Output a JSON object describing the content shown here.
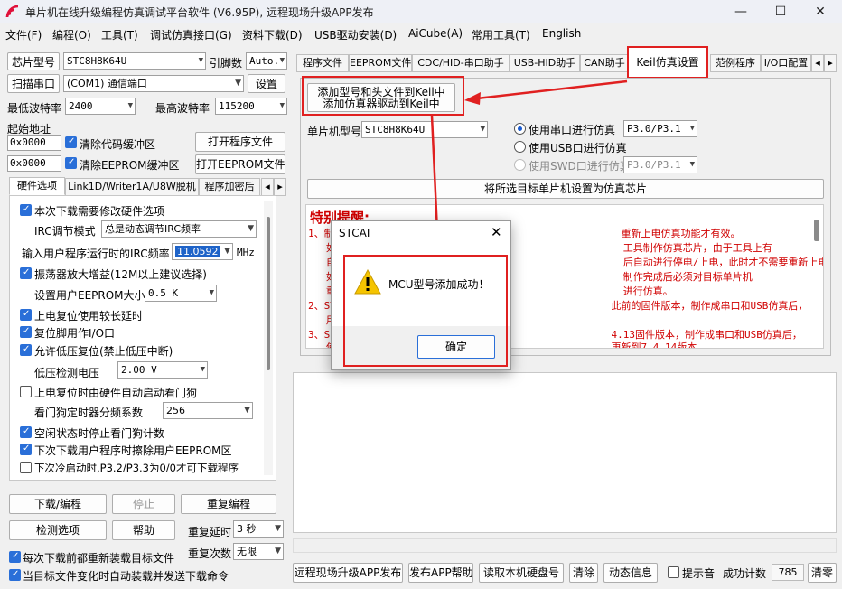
{
  "window": {
    "title": "单片机在线升级编程仿真调试平台软件 (V6.95P), 远程现场升级APP发布"
  },
  "menu": [
    "文件(F)",
    "编程(O)",
    "工具(T)",
    "调试仿真接口(G)",
    "资料下载(D)",
    "USB驱动安装(D)",
    "AiCube(A)",
    "常用工具(T)",
    "English"
  ],
  "left": {
    "chip_label": "芯片型号",
    "chip_value": "STC8H8K64U",
    "pin_label": "引脚数",
    "pin_value": "Auto.",
    "scan_btn": "扫描串口",
    "port_value": "(COM1) 通信端口",
    "settings_btn": "设置",
    "min_baud_label": "最低波特率",
    "min_baud": "2400",
    "max_baud_label": "最高波特率",
    "max_baud": "115200",
    "start_addr_label": "起始地址",
    "addr1": "0x0000",
    "clear_code": "清除代码缓冲区",
    "open_prog_btn": "打开程序文件",
    "addr2": "0x0000",
    "clear_eeprom": "清除EEPROM缓冲区",
    "open_eeprom_btn": "打开EEPROM文件",
    "tabs": [
      "硬件选项",
      "Link1D/Writer1A/U8W脱机",
      "程序加密后"
    ],
    "options": {
      "modify_hw": "本次下载需要修改硬件选项",
      "irc_mode_label": "IRC调节模式",
      "irc_mode_value": "总是动态调节IRC频率",
      "irc_freq_label": "输入用户程序运行时的IRC频率",
      "irc_freq_value": "11.0592",
      "irc_unit": "MHz",
      "osc_gain": "振荡器放大增益(12M以上建议选择)",
      "eeprom_size_label": "设置用户EEPROM大小",
      "eeprom_size_value": "0.5 K",
      "long_reset": "上电复位使用较长延时",
      "reset_io": "复位脚用作I/O口",
      "lvr": "允许低压复位(禁止低压中断)",
      "lv_label": "低压检测电压",
      "lv_value": "2.00 V",
      "wdt_hw": "上电复位时由硬件自动启动看门狗",
      "wdt_div_label": "看门狗定时器分频系数",
      "wdt_div_value": "256",
      "idle_wdt": "空闲状态时停止看门狗计数",
      "erase_eeprom": "下次下载用户程序时擦除用户EEPROM区",
      "cold_boot": "下次冷启动时,P3.2/P3.3为0/0才可下载程序"
    },
    "download_btn": "下载/编程",
    "stop_btn": "停止",
    "reprog_btn": "重复编程",
    "check_btn": "检测选项",
    "help_btn": "帮助",
    "repeat_delay_label": "重复延时",
    "repeat_delay": "3 秒",
    "repeat_count_label": "重复次数",
    "repeat_count": "无限",
    "reload_each": "每次下载前都重新装载目标文件",
    "auto_send": "当目标文件变化时自动装载并发送下载命令"
  },
  "right": {
    "tabs": [
      "程序文件",
      "EEPROM文件",
      "CDC/HID-串口助手",
      "USB-HID助手",
      "CAN助手",
      "Keil仿真设置",
      "范例程序",
      "I/O口配置"
    ],
    "add_btn_line1": "添加型号和头文件到Keil中",
    "add_btn_line2": "添加仿真器驱动到Keil中",
    "mcu_label": "单片机型号",
    "mcu_value": "STC8H8K64U",
    "radio_serial": "使用串口进行仿真",
    "serial_port": "P3.0/P3.1",
    "radio_usb": "使用USB口进行仿真",
    "radio_swd": "使用SWD口进行仿真",
    "swd_port": "P3.0/P3.1",
    "set_chip_btn": "将所选目标单片机设置为仿真芯片",
    "warn_title": "特别提醒:",
    "warn_lines": [
      "1、制                                                重新上电仿真功能才有效。",
      "   如                                                工具制作仿真芯片，由于工具上有",
      "   自                                                后自动进行停电/上电，此时才不需要重新上电。",
      "   如                                                制作完成后必须对目标单片机",
      "   重                                                进行仿真。",
      "2、ST                                              此前的固件版本，制作成串口和USB仿真后，",
      "   用",
      "3、S                                               4.13固件版本，制作成串口和USB仿真后，",
      "   使                                              更新到7.4.14版本"
    ]
  },
  "bottom": {
    "remote_btn": "远程现场升级APP发布",
    "publish_help_btn": "发布APP帮助",
    "read_disk_btn": "读取本机硬盘号",
    "clear_btn": "清除",
    "dynamic_btn": "动态信息",
    "beep_label": "提示音",
    "success_label": "成功计数",
    "success_count": "785",
    "reset_btn": "清零"
  },
  "dialog": {
    "title": "STCAI",
    "message": "MCU型号添加成功！",
    "ok": "确定"
  }
}
